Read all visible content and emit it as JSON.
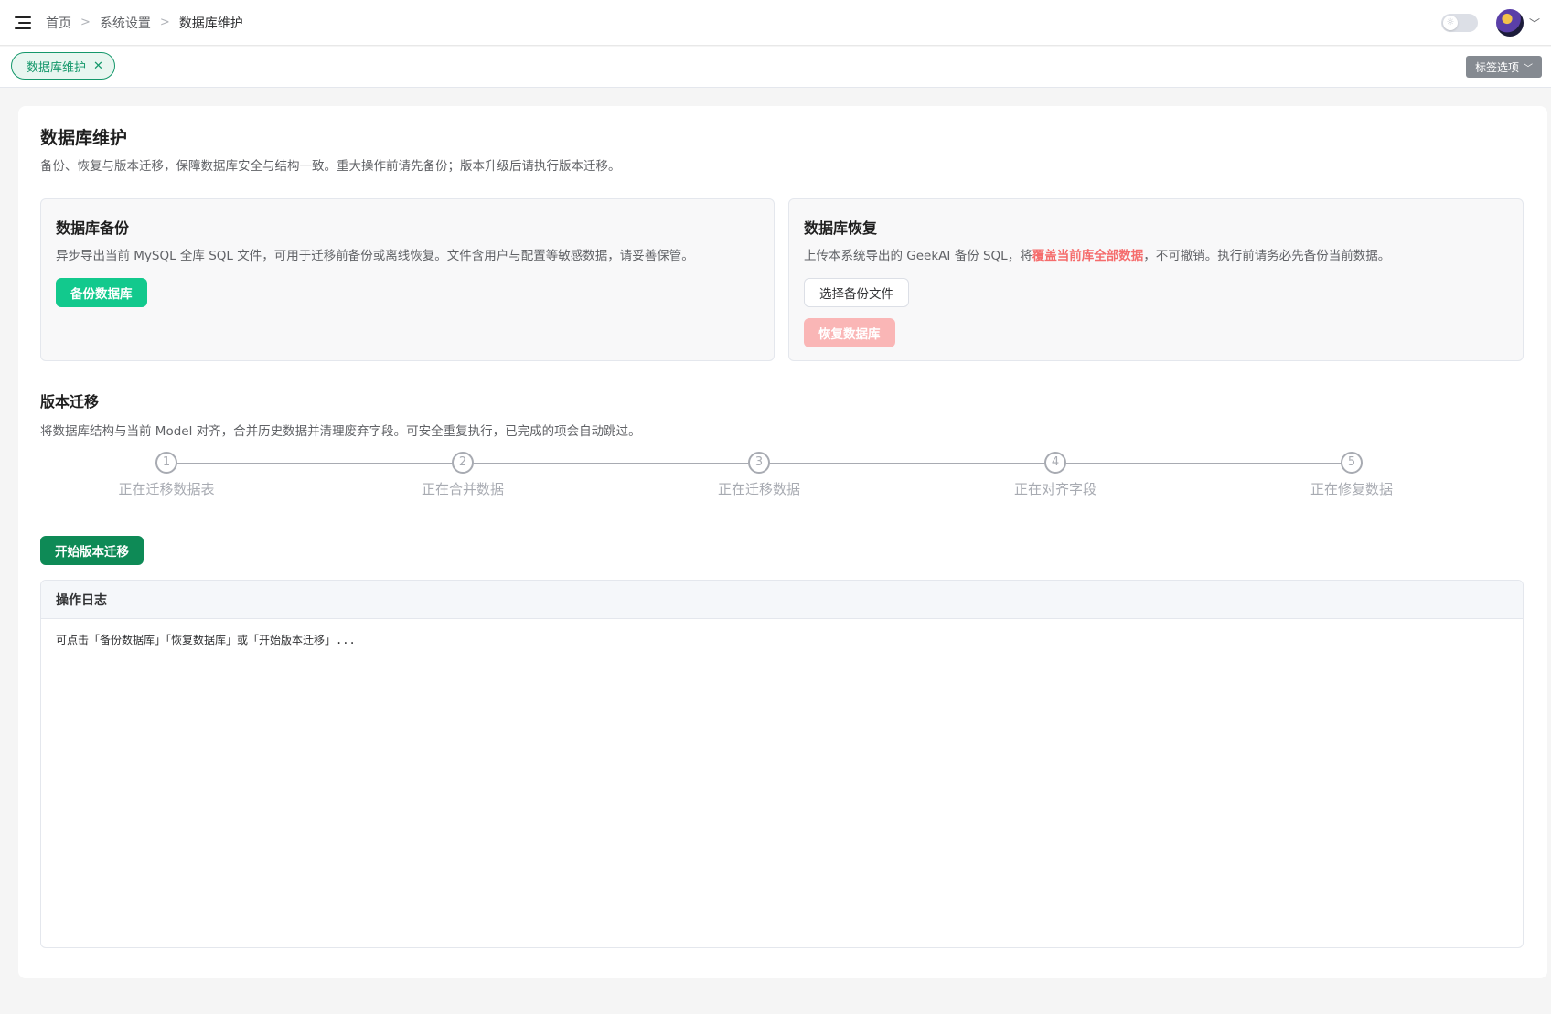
{
  "breadcrumb": [
    "首页",
    "系统设置",
    "数据库维护"
  ],
  "tabs": [
    {
      "label": "数据库维护"
    }
  ],
  "tag_options_label": "标签选项",
  "page": {
    "title": "数据库维护",
    "description": "备份、恢复与版本迁移，保障数据库安全与结构一致。重大操作前请先备份；版本升级后请执行版本迁移。"
  },
  "backup": {
    "title": "数据库备份",
    "description": "异步导出当前 MySQL 全库 SQL 文件，可用于迁移前备份或离线恢复。文件含用户与配置等敏感数据，请妥善保管。",
    "button": "备份数据库"
  },
  "restore": {
    "title": "数据库恢复",
    "description_before": "上传本系统导出的 GeekAI 备份 SQL，将",
    "description_warning": "覆盖当前库全部数据",
    "description_after": "，不可撤销。执行前请务必先备份当前数据。",
    "choose_button": "选择备份文件",
    "restore_button": "恢复数据库"
  },
  "migration": {
    "title": "版本迁移",
    "description": "将数据库结构与当前 Model 对齐，合并历史数据并清理废弃字段。可安全重复执行，已完成的项会自动跳过。",
    "steps": [
      {
        "number": "1",
        "label": "正在迁移数据表"
      },
      {
        "number": "2",
        "label": "正在合并数据"
      },
      {
        "number": "3",
        "label": "正在迁移数据"
      },
      {
        "number": "4",
        "label": "正在对齐字段"
      },
      {
        "number": "5",
        "label": "正在修复数据"
      }
    ],
    "button": "开始版本迁移"
  },
  "log": {
    "title": "操作日志",
    "content": "可点击「备份数据库」「恢复数据库」或「开始版本迁移」..."
  },
  "colors": {
    "primary": "#12c98d",
    "migrate": "#0e8a56",
    "danger": "#f56c6c",
    "danger_disabled": "#fab6b6",
    "step_inactive": "#a8abb2"
  }
}
